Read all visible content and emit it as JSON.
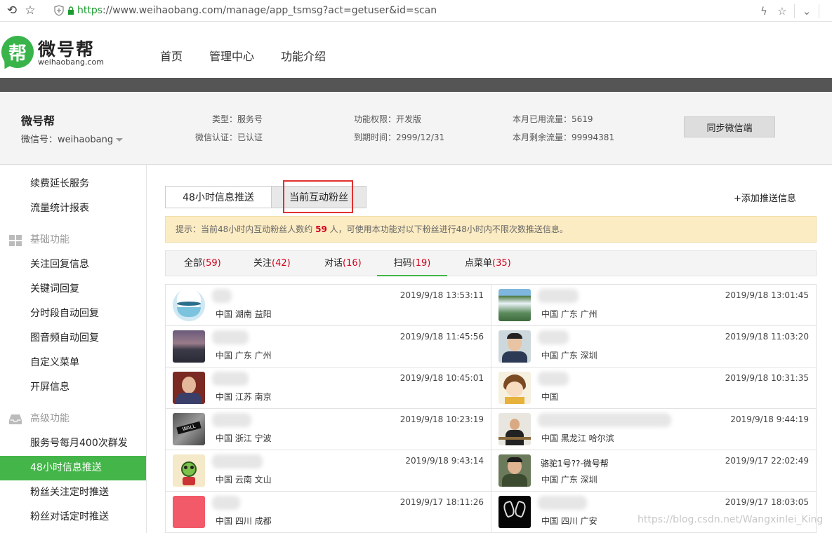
{
  "browser": {
    "url_scheme": "https",
    "url_rest": "://www.weihaobang.com/manage/app_tsmsg?act=getuser&id=scan"
  },
  "site": {
    "logo_char": "帮",
    "logo_name": "微号帮",
    "logo_sub": "weihaobang.com",
    "nav": [
      "首页",
      "管理中心",
      "功能介绍"
    ]
  },
  "account": {
    "name": "微号帮",
    "wechat_id": "微信号：weihaobang",
    "type": "类型：服务号",
    "verify": "微信认证：已认证",
    "permission": "功能权限：开发版",
    "expire": "到期时间：2999/12/31",
    "used_traffic": "本月已用流量：5619",
    "remain_traffic": "本月剩余流量：99994381",
    "sync_label": "同步微信端"
  },
  "sidebar": {
    "items_top": [
      "续费延长服务",
      "流量统计报表"
    ],
    "group_basic": "基础功能",
    "items_basic": [
      "关注回复信息",
      "关键词回复",
      "分时段自动回复",
      "图音频自动回复",
      "自定义菜单",
      "开屏信息"
    ],
    "group_advanced": "高级功能",
    "items_advanced": [
      "服务号每月400次群发",
      "48小时信息推送",
      "粉丝关注定时推送",
      "粉丝对话定时推送"
    ]
  },
  "tabs": {
    "t48": "48小时信息推送",
    "current": "当前互动粉丝",
    "add_push": "+添加推送信息"
  },
  "tip": {
    "prefix": "提示：当前48小时内互动粉丝人数约 ",
    "count": "59",
    "suffix": " 人，可使用本功能对以下粉丝进行48小时内不限次数推送信息。"
  },
  "filters": [
    {
      "label": "全部",
      "count": "(59)"
    },
    {
      "label": "关注",
      "count": "(42)"
    },
    {
      "label": "对话",
      "count": "(16)"
    },
    {
      "label": "扫码",
      "count": "(19)"
    },
    {
      "label": "点菜单",
      "count": "(35)"
    }
  ],
  "fans": [
    {
      "nick": "",
      "loc": "中国 湖南 益阳",
      "time": "2019/9/18 13:53:11"
    },
    {
      "nick": "",
      "loc": "中国 广东 广州",
      "time": "2019/9/18 13:01:45"
    },
    {
      "nick": "",
      "loc": "中国 广东 广州",
      "time": "2019/9/18 11:45:56"
    },
    {
      "nick": "",
      "loc": "中国 广东 深圳",
      "time": "2019/9/18 11:03:20"
    },
    {
      "nick": "",
      "loc": "中国 江苏 南京",
      "time": "2019/9/18 10:45:01"
    },
    {
      "nick": "",
      "loc": "中国",
      "time": "2019/9/18 10:31:35"
    },
    {
      "nick": "",
      "loc": "中国 浙江 宁波",
      "time": "2019/9/18 10:23:19"
    },
    {
      "nick": "",
      "loc": "中国 黑龙江 哈尔滨",
      "time": "2019/9/18 9:44:19"
    },
    {
      "nick": "",
      "loc": "中国 云南 文山",
      "time": "2019/9/18 9:43:14"
    },
    {
      "nick": "骆驼1号??-微号帮",
      "loc": "中国 广东 深圳",
      "time": "2019/9/17 22:02:49"
    },
    {
      "nick": "",
      "loc": "中国 四川 成都",
      "time": "2019/9/17 18:11:26"
    },
    {
      "nick": "",
      "loc": "中国 四川 广安",
      "time": "2019/9/17 18:03:05"
    }
  ],
  "watermark": "https://blog.csdn.net/Wangxinlei_King"
}
